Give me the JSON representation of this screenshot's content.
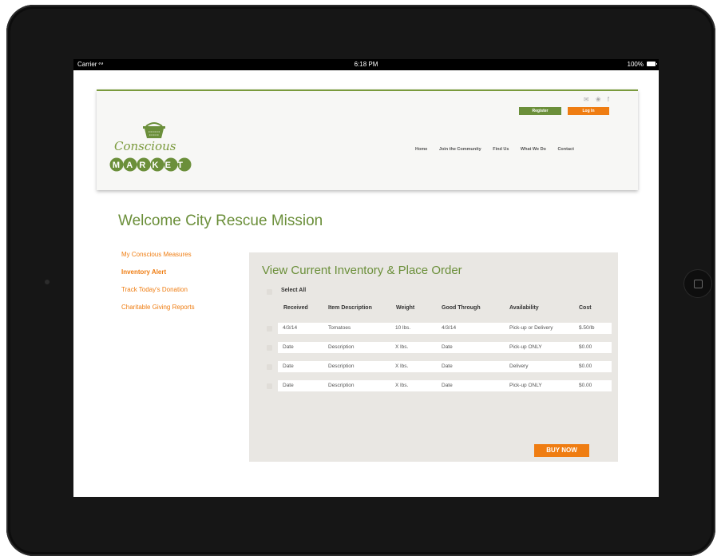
{
  "status_bar": {
    "carrier": "Carrier",
    "wifi_icon": "wifi-icon",
    "time": "6:18 PM",
    "battery": "100%"
  },
  "header": {
    "social_icons": [
      "mail-icon",
      "twitter-icon",
      "facebook-icon"
    ],
    "register_label": "Register",
    "login_label": "Log In",
    "nav": [
      "Home",
      "Join the Community",
      "Find Us",
      "What We Do",
      "Contact"
    ],
    "logo": {
      "script": "Conscious",
      "market": "MARKET"
    }
  },
  "page_title": "Welcome City Rescue Mission",
  "sidebar": [
    {
      "label": "My Conscious Measures",
      "active": false
    },
    {
      "label": "Inventory Alert",
      "active": true
    },
    {
      "label": "Track Today's Donation",
      "active": false
    },
    {
      "label": "Charitable Giving Reports",
      "active": false
    }
  ],
  "inventory": {
    "title": "View Current Inventory & Place Order",
    "select_all": "Select All",
    "columns": [
      "Received",
      "Item Description",
      "Weight",
      "Good Through",
      "Availability",
      "Cost"
    ],
    "rows": [
      [
        "4/3/14",
        "Tomatoes",
        "10 lbs.",
        "4/3/14",
        "Pick-up or Delivery",
        "$.50/lb"
      ],
      [
        "Date",
        "Description",
        "X lbs.",
        "Date",
        "Pick-up ONLY",
        "$0.00"
      ],
      [
        "Date",
        "Description",
        "X lbs.",
        "Date",
        "Delivery",
        "$0.00"
      ],
      [
        "Date",
        "Description",
        "X lbs.",
        "Date",
        "Pick-up ONLY",
        "$0.00"
      ]
    ],
    "buy_now": "BUY NOW"
  },
  "colors": {
    "green": "#6b8f3a",
    "orange": "#ef7d12",
    "panel": "#e9e7e3"
  }
}
